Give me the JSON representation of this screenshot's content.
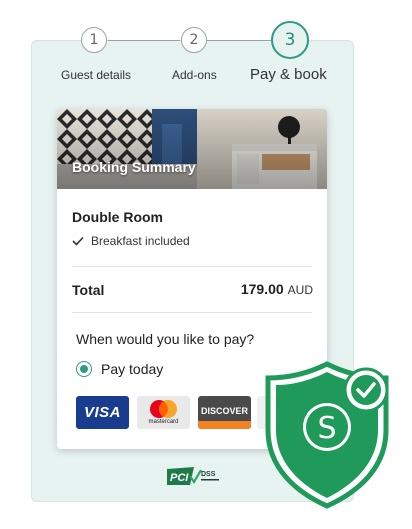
{
  "stepper": {
    "steps": [
      {
        "number": "1",
        "label": "Guest details"
      },
      {
        "number": "2",
        "label": "Add-ons"
      },
      {
        "number": "3",
        "label": "Pay & book"
      }
    ],
    "active_step": 3
  },
  "booking": {
    "header_title": "Booking Summary",
    "room_name": "Double Room",
    "inclusions": [
      "Breakfast included"
    ],
    "total_label": "Total",
    "total_amount": "179.00",
    "currency": "AUD"
  },
  "payment": {
    "question": "When would you like to pay?",
    "options": [
      {
        "label": "Pay today",
        "selected": true
      }
    ],
    "card_logos": [
      {
        "name": "visa-logo",
        "text": "VISA",
        "color": "#1a3c8f"
      },
      {
        "name": "mastercard-logo",
        "text": "mastercard",
        "color": "#e9e9e9"
      },
      {
        "name": "discover-logo",
        "text": "DISCOVER",
        "color": "#4a4a4a"
      },
      {
        "name": "card-logo-partial"
      }
    ]
  },
  "badges": {
    "pci": {
      "text_main": "PCI",
      "text_sub": "DSS"
    },
    "shield_letter": "S"
  },
  "colors": {
    "accent": "#2f9a86",
    "panel_bg": "#e7f3f1",
    "shield": "#1f9a5a"
  }
}
